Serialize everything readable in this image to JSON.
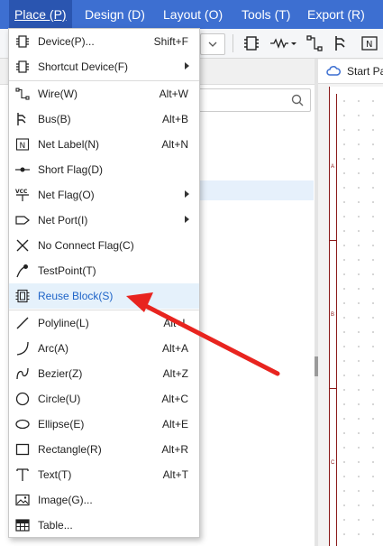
{
  "menubar": {
    "items": [
      {
        "label": "Place (P)"
      },
      {
        "label": "Design (D)"
      },
      {
        "label": "Layout (O)"
      },
      {
        "label": "Tools (T)"
      },
      {
        "label": "Export (R)"
      }
    ]
  },
  "canvas": {
    "tab_label": "Start Pa",
    "zone_labels": [
      "A",
      "B",
      "C"
    ]
  },
  "place_menu": {
    "items": [
      {
        "label": "Device(P)...",
        "shortcut": "Shift+F",
        "icon": "chip-icon"
      },
      {
        "label": "Shortcut Device(F)",
        "shortcut": "",
        "icon": "chip-icon",
        "submenu": true
      },
      {
        "label": "Wire(W)",
        "shortcut": "Alt+W",
        "icon": "wire-icon"
      },
      {
        "label": "Bus(B)",
        "shortcut": "Alt+B",
        "icon": "bus-icon"
      },
      {
        "label": "Net Label(N)",
        "shortcut": "Alt+N",
        "icon": "net-label-icon"
      },
      {
        "label": "Short Flag(D)",
        "shortcut": "",
        "icon": "short-flag-icon"
      },
      {
        "label": "Net Flag(O)",
        "shortcut": "",
        "icon": "net-flag-icon",
        "submenu": true,
        "icon_text": "VCC"
      },
      {
        "label": "Net Port(I)",
        "shortcut": "",
        "icon": "net-port-icon",
        "submenu": true
      },
      {
        "label": "No Connect Flag(C)",
        "shortcut": "",
        "icon": "no-connect-icon"
      },
      {
        "label": "TestPoint(T)",
        "shortcut": "",
        "icon": "testpoint-icon"
      },
      {
        "label": "Reuse Block(S)",
        "shortcut": "",
        "icon": "reuse-block-icon",
        "highlighted": true
      },
      {
        "label": "Polyline(L)",
        "shortcut": "Alt+L",
        "icon": "polyline-icon"
      },
      {
        "label": "Arc(A)",
        "shortcut": "Alt+A",
        "icon": "arc-icon"
      },
      {
        "label": "Bezier(Z)",
        "shortcut": "Alt+Z",
        "icon": "bezier-icon"
      },
      {
        "label": "Circle(U)",
        "shortcut": "Alt+C",
        "icon": "circle-icon"
      },
      {
        "label": "Ellipse(E)",
        "shortcut": "Alt+E",
        "icon": "ellipse-icon"
      },
      {
        "label": "Rectangle(R)",
        "shortcut": "Alt+R",
        "icon": "rectangle-icon"
      },
      {
        "label": "Text(T)",
        "shortcut": "Alt+T",
        "icon": "text-icon"
      },
      {
        "label": "Image(G)...",
        "shortcut": "",
        "icon": "image-icon"
      },
      {
        "label": "Table...",
        "shortcut": "",
        "icon": "table-icon"
      }
    ]
  },
  "colors": {
    "menubar_bg": "#3d6fd1",
    "highlight_bg": "#e5f1fb",
    "highlight_text": "#1e64c8",
    "annotation_arrow": "#e8241f"
  }
}
